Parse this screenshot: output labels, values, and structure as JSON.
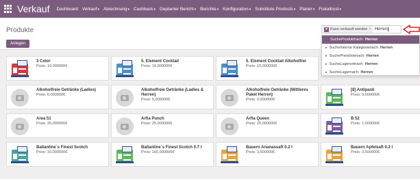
{
  "app": {
    "title": "Verkauf"
  },
  "menu": [
    {
      "label": "Dashboard",
      "caret": false
    },
    {
      "label": "Verkauf",
      "caret": true
    },
    {
      "label": "Abrechnung",
      "caret": true
    },
    {
      "label": "Cashback",
      "caret": true
    },
    {
      "label": "Geplanter Bericht",
      "caret": true
    },
    {
      "label": "Berichte",
      "caret": true
    },
    {
      "label": "Konfiguration",
      "caret": true
    },
    {
      "label": "Substitute Products",
      "caret": true
    },
    {
      "label": "Planer",
      "caret": true
    },
    {
      "label": "Fiskaltrust",
      "caret": true
    }
  ],
  "page": {
    "title": "Produkte",
    "create_label": "Anlegen"
  },
  "search": {
    "facet": "Kann verkauft werden",
    "value": "Herren"
  },
  "dropdown": [
    {
      "prefix": "Suche ",
      "field": "Produkt",
      "suffix": " nach:",
      "term": "Herren",
      "active": true,
      "expandable": false
    },
    {
      "prefix": "Suche ",
      "field": "Interne Kategorie",
      "suffix": " nach:",
      "term": "Herren",
      "active": false,
      "expandable": true
    },
    {
      "prefix": "Suche ",
      "field": "Preisliste",
      "suffix": " nach:",
      "term": "Herren",
      "active": false,
      "expandable": true
    },
    {
      "prefix": "Suche ",
      "field": "Lagerort",
      "suffix": " nach:",
      "term": "Herren",
      "active": false,
      "expandable": true
    },
    {
      "prefix": "Suche ",
      "field": "Lager",
      "suffix": " nach:",
      "term": "Herren",
      "active": false,
      "expandable": true
    }
  ],
  "products": [
    {
      "name": "3 Color",
      "price": "Preis: 10,000000€",
      "thumb": "register",
      "color": "#d9363e"
    },
    {
      "name": "5. Element Cocktail",
      "price": "Preis: 15,000000€",
      "thumb": "register",
      "color": "#4a90c8"
    },
    {
      "name": "5. Element Cocktail Alkoholfrei",
      "price": "Preis: 15,000000€",
      "thumb": "register",
      "color": "#4a90c8"
    },
    {
      "name": "",
      "price": "",
      "thumb": "none",
      "color": ""
    },
    {
      "name": "Alkoholfreie Getränke (Ladies)",
      "price": "Preis: 0,000000€",
      "thumb": "placeholder",
      "color": ""
    },
    {
      "name": "Alkoholfreie Getränke (Ladies & Herren)",
      "price": "Preis: 0,000000€",
      "thumb": "placeholder",
      "color": ""
    },
    {
      "name": "Alkoholfreie Getränke (Mittleres Paket Herren)",
      "price": "Preis: 0,000000€",
      "thumb": "placeholder",
      "color": ""
    },
    {
      "name": "[8] Antipasti",
      "price": "Preis: 9,000000€",
      "thumb": "register",
      "color": "#5cb85c"
    },
    {
      "name": "Area 51",
      "price": "Preis: 25,000000€",
      "thumb": "placeholder",
      "color": ""
    },
    {
      "name": "Arfia Punch",
      "price": "Preis: 25,000000€",
      "thumb": "placeholder",
      "color": ""
    },
    {
      "name": "Arfia Queen",
      "price": "Preis: 25,000000€",
      "thumb": "placeholder",
      "color": ""
    },
    {
      "name": "B 52",
      "price": "Preis: 7,000000€",
      "thumb": "register",
      "color": "#7c5c9e"
    },
    {
      "name": "Ballantine`s Finest Scotch",
      "price": "Preis: 10,000000€",
      "thumb": "register",
      "color": "#4aa3a0"
    },
    {
      "name": "Ballantine`s Finest Scotch 0.7 l",
      "price": "Preis: 160,000000€",
      "thumb": "register",
      "color": "#5cb85c"
    },
    {
      "name": "Bauern Ananassaft 0.2 l",
      "price": "Preis: 3,500000€",
      "thumb": "register",
      "color": "#e8a33c"
    },
    {
      "name": "Bauern Apfelsaft 0.2 l",
      "price": "Preis: 3,500000€",
      "thumb": "register",
      "color": "#e8a33c"
    }
  ],
  "colors": {
    "brand": "#7c5c7e",
    "arrow": "#e02020"
  }
}
